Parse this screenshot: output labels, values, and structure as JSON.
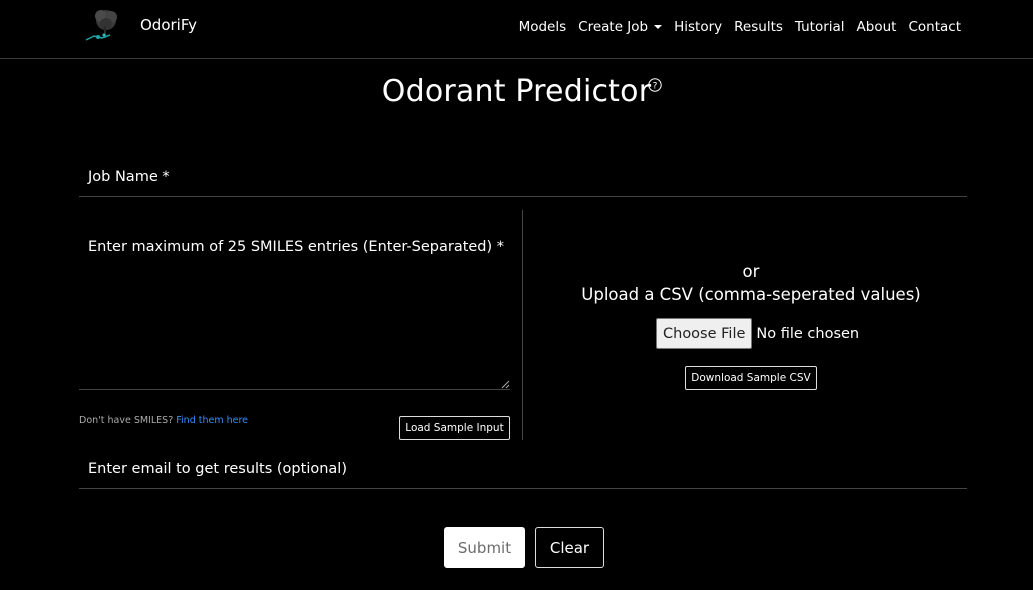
{
  "navbar": {
    "brand": "OdoriFy",
    "items": [
      {
        "label": "Models"
      },
      {
        "label": "Create Job"
      },
      {
        "label": "History"
      },
      {
        "label": "Results"
      },
      {
        "label": "Tutorial"
      },
      {
        "label": "About"
      },
      {
        "label": "Contact"
      }
    ]
  },
  "page": {
    "title": "Odorant Predictor"
  },
  "form": {
    "job_name_label": "Job Name *",
    "smiles_label": "Enter maximum of 25 SMILES entries (Enter-Separated) *",
    "hint_text": "Don't have SMILES?",
    "hint_link": "Find them here",
    "load_sample_label": "Load Sample Input",
    "or_text": "or",
    "upload_text": "Upload a CSV (comma-seperated values)",
    "choose_file_label": "Choose File",
    "no_file_text": "No file chosen",
    "download_sample_label": "Download Sample CSV",
    "email_label": "Enter email to get results (optional)",
    "submit_label": "Submit",
    "clear_label": "Clear"
  },
  "colors": {
    "background": "#000000",
    "text": "#ffffff",
    "link": "#3a8cff",
    "divider": "#444444"
  }
}
